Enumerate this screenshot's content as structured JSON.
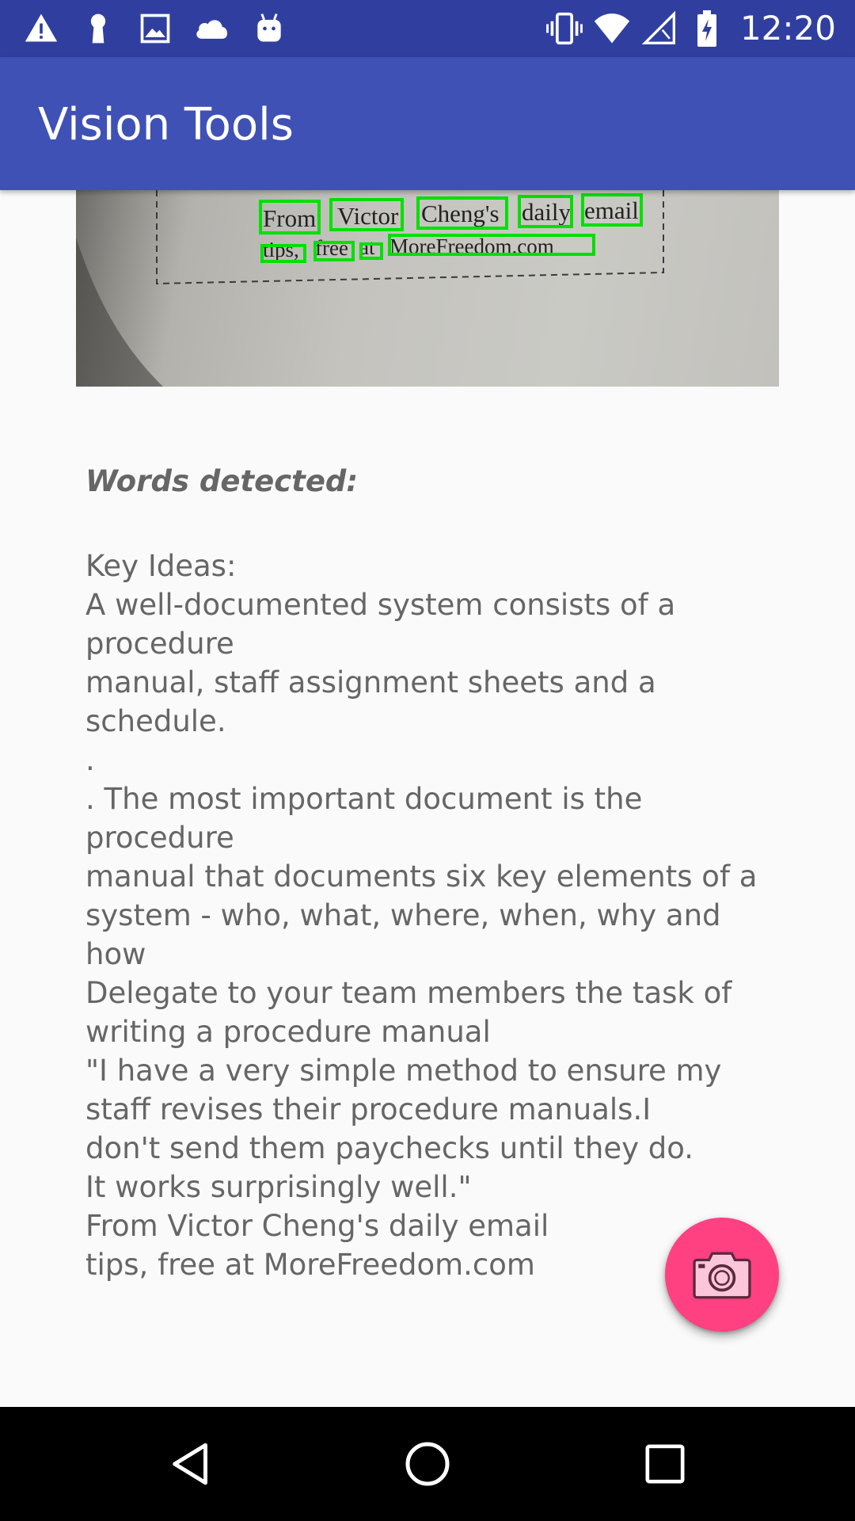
{
  "status_bar": {
    "time": "12:20",
    "left_icons": [
      "warning-icon",
      "keyhole-icon",
      "image-icon",
      "cloud-icon",
      "android-icon"
    ],
    "right_icons": [
      "vibrate-icon",
      "wifi-icon",
      "signal-icon",
      "battery-charging-icon"
    ]
  },
  "app_bar": {
    "title": "Vision Tools"
  },
  "photo": {
    "line1_words": [
      "From",
      "Victor",
      "Cheng's",
      "daily",
      "email"
    ],
    "line2_words": [
      "tips,",
      "free",
      "at",
      "MoreFreedom.com"
    ],
    "detection_box_color": "#00e000"
  },
  "words_label": "Words detected:",
  "detected_text": "Key Ideas:\nA well-documented system consists of a\nprocedure\nmanual, staff assignment sheets and a\nschedule.\n.\n. The most important document is the\nprocedure\nmanual that documents six key elements of a\nsystem - who, what, where, when, why and\nhow\nDelegate to your team members the task of\nwriting a procedure manual\n\"I have a very simple method to ensure my\nstaff revises their procedure manuals.I\ndon't send them paychecks until they do.\nIt works surprisingly well.\"\nFrom Victor Cheng's daily email\ntips, free at MoreFreedom.com",
  "fab": {
    "icon": "camera-icon",
    "color": "#ff4081"
  },
  "nav_bar": {
    "buttons": [
      "back-icon",
      "home-icon",
      "recents-icon"
    ]
  },
  "colors": {
    "status_bar": "#303f9f",
    "app_bar": "#3f51b5",
    "body_text": "#666666",
    "background": "#fafafa"
  }
}
